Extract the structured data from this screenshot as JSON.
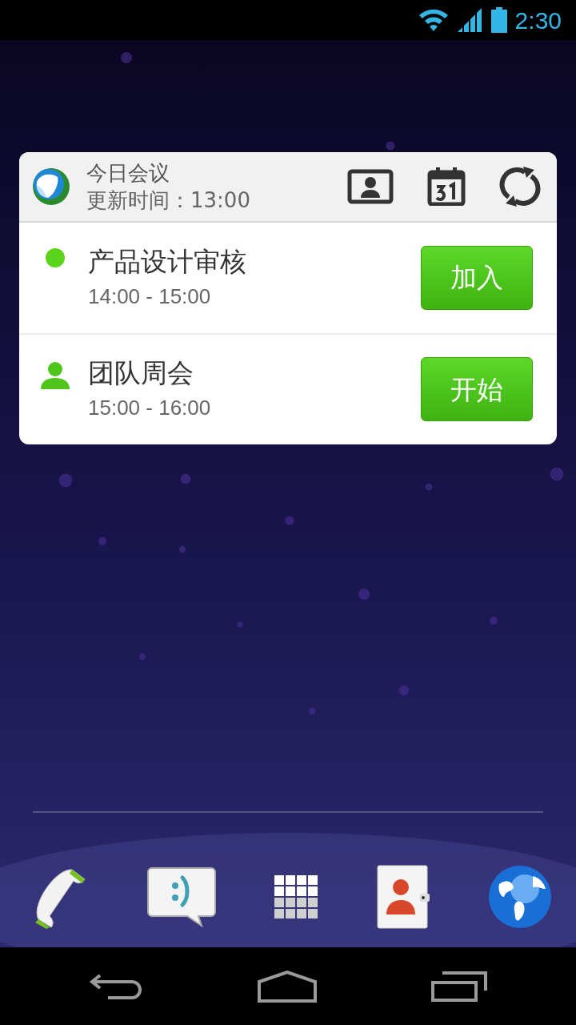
{
  "status_bar": {
    "time": "2:30"
  },
  "widget": {
    "title": "今日会议",
    "updated": "更新时间：13:00",
    "meetings": [
      {
        "kind": "dot",
        "title": "产品设计审核",
        "time": "14:00 - 15:00",
        "action": "加入"
      },
      {
        "kind": "person",
        "title": "团队周会",
        "time": "15:00 - 16:00",
        "action": "开始"
      }
    ]
  }
}
